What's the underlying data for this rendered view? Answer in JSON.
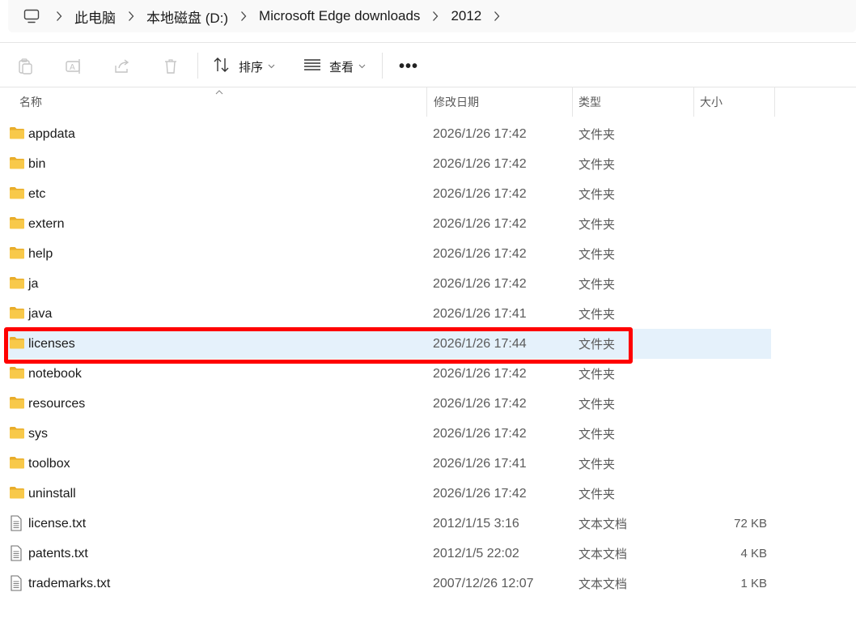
{
  "breadcrumb": {
    "items": [
      "此电脑",
      "本地磁盘 (D:)",
      "Microsoft Edge downloads",
      "2012"
    ]
  },
  "toolbar": {
    "sort_label": "排序",
    "view_label": "查看",
    "more_label": "•••"
  },
  "columns": {
    "name": "名称",
    "date": "修改日期",
    "type": "类型",
    "size": "大小"
  },
  "files": [
    {
      "name": "appdata",
      "date": "2026/1/26 17:42",
      "type": "文件夹",
      "size": "",
      "kind": "folder"
    },
    {
      "name": "bin",
      "date": "2026/1/26 17:42",
      "type": "文件夹",
      "size": "",
      "kind": "folder"
    },
    {
      "name": "etc",
      "date": "2026/1/26 17:42",
      "type": "文件夹",
      "size": "",
      "kind": "folder"
    },
    {
      "name": "extern",
      "date": "2026/1/26 17:42",
      "type": "文件夹",
      "size": "",
      "kind": "folder"
    },
    {
      "name": "help",
      "date": "2026/1/26 17:42",
      "type": "文件夹",
      "size": "",
      "kind": "folder"
    },
    {
      "name": "ja",
      "date": "2026/1/26 17:42",
      "type": "文件夹",
      "size": "",
      "kind": "folder"
    },
    {
      "name": "java",
      "date": "2026/1/26 17:41",
      "type": "文件夹",
      "size": "",
      "kind": "folder"
    },
    {
      "name": "licenses",
      "date": "2026/1/26 17:44",
      "type": "文件夹",
      "size": "",
      "kind": "folder",
      "selected": true
    },
    {
      "name": "notebook",
      "date": "2026/1/26 17:42",
      "type": "文件夹",
      "size": "",
      "kind": "folder"
    },
    {
      "name": "resources",
      "date": "2026/1/26 17:42",
      "type": "文件夹",
      "size": "",
      "kind": "folder"
    },
    {
      "name": "sys",
      "date": "2026/1/26 17:42",
      "type": "文件夹",
      "size": "",
      "kind": "folder"
    },
    {
      "name": "toolbox",
      "date": "2026/1/26 17:41",
      "type": "文件夹",
      "size": "",
      "kind": "folder"
    },
    {
      "name": "uninstall",
      "date": "2026/1/26 17:42",
      "type": "文件夹",
      "size": "",
      "kind": "folder"
    },
    {
      "name": "license.txt",
      "date": "2012/1/15 3:16",
      "type": "文本文档",
      "size": "72 KB",
      "kind": "text"
    },
    {
      "name": "patents.txt",
      "date": "2012/1/5 22:02",
      "type": "文本文档",
      "size": "4 KB",
      "kind": "text"
    },
    {
      "name": "trademarks.txt",
      "date": "2007/12/26 12:07",
      "type": "文本文档",
      "size": "1 KB",
      "kind": "text"
    }
  ],
  "colors": {
    "folder": "#f8c94a",
    "folder_dark": "#e9ad2b",
    "selection": "#e5f1fb",
    "highlight_box": "#ff0000"
  }
}
